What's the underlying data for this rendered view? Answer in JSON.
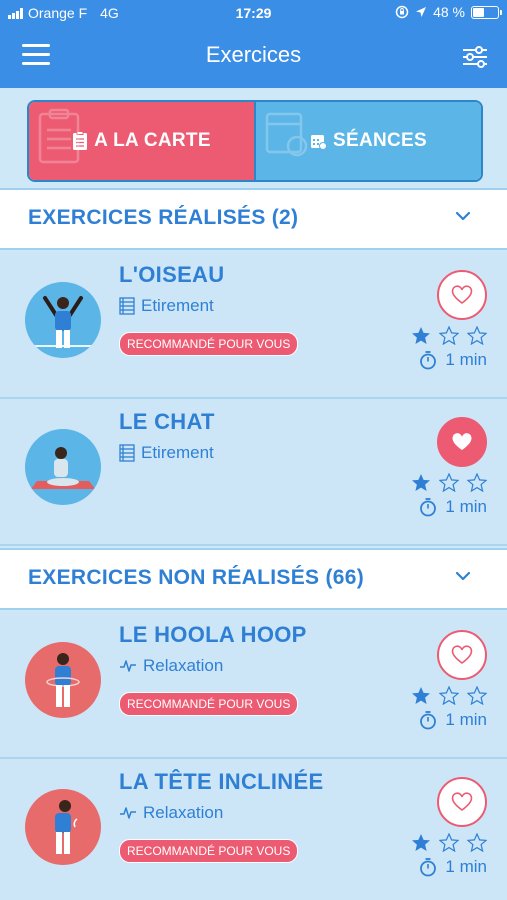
{
  "status": {
    "carrier": "Orange F",
    "network": "4G",
    "time": "17:29",
    "battery": "48 %"
  },
  "nav": {
    "title": "Exercices"
  },
  "tabs": [
    {
      "label": "A LA CARTE",
      "active": true
    },
    {
      "label": "SÉANCES",
      "active": false
    }
  ],
  "sections": [
    {
      "title": "EXERCICES RÉALISÉS (2)"
    },
    {
      "title": "EXERCICES NON RÉALISÉS (66)"
    }
  ],
  "exercises": [
    {
      "name": "L'OISEAU",
      "category": "Etirement",
      "badge": "RECOMMANDÉ POUR VOUS",
      "favorite": false,
      "stars_filled": 1,
      "stars_total": 3,
      "duration": "1 min",
      "category_icon": "list-icon",
      "avatar_bg": "#5bb5e6"
    },
    {
      "name": "LE CHAT",
      "category": "Etirement",
      "badge": "",
      "favorite": true,
      "stars_filled": 1,
      "stars_total": 3,
      "duration": "1 min",
      "category_icon": "list-icon",
      "avatar_bg": "#5bb5e6"
    },
    {
      "name": "LE HOOLA HOOP",
      "category": "Relaxation",
      "badge": "RECOMMANDÉ POUR VOUS",
      "favorite": false,
      "stars_filled": 1,
      "stars_total": 3,
      "duration": "1 min",
      "category_icon": "pulse-icon",
      "avatar_bg": "#e86b6b"
    },
    {
      "name": "LA TÊTE INCLINÉE",
      "category": "Relaxation",
      "badge": "RECOMMANDÉ POUR VOUS",
      "favorite": false,
      "stars_filled": 1,
      "stars_total": 3,
      "duration": "1 min",
      "category_icon": "pulse-icon",
      "avatar_bg": "#e86b6b"
    }
  ],
  "colors": {
    "header": "#3a8ee6",
    "accent_red": "#ec5b72",
    "accent_blue": "#2f80d4",
    "card_bg": "#cce6f8"
  }
}
